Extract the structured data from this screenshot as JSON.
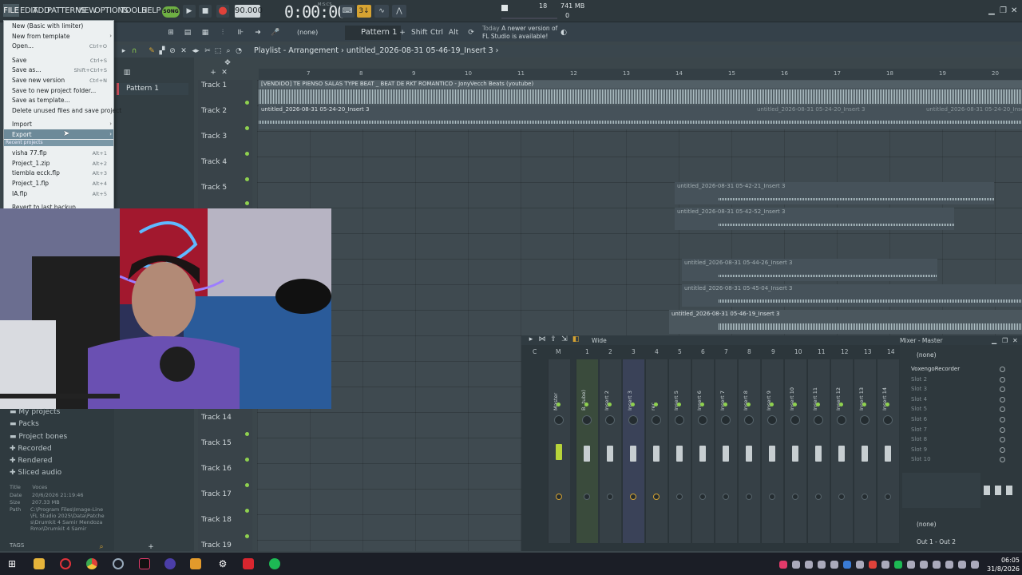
{
  "menu": {
    "items": [
      "FILE",
      "EDIT",
      "ADD",
      "PATTERNS",
      "VIEW",
      "OPTIONS",
      "TOOLS",
      "HELP"
    ],
    "song_label": "SONG"
  },
  "transport": {
    "tempo": "90.000",
    "time": "0:00:00",
    "time_unit": "M:S:CS",
    "cpu": "18",
    "cpu_zero": "0",
    "memory": "741 MB"
  },
  "toolbar2": {
    "none_selector": "(none)",
    "pattern_selector": "Pattern 1",
    "shift": "Shift",
    "ctrl": "Ctrl",
    "alt": "Alt",
    "news_today": "Today",
    "news_text": "A newer version of FL Studio is available!"
  },
  "playlist": {
    "title": "Playlist - Arrangement",
    "breadcrumb": "untitled_2026-08-31 05-46-19_Insert 3",
    "pattern": "Pattern 1",
    "ruler": [
      "7",
      "8",
      "9",
      "10",
      "11",
      "12",
      "13",
      "14",
      "15",
      "16",
      "17",
      "18",
      "19",
      "20"
    ],
    "tracks": [
      "Track 1",
      "Track 2",
      "Track 3",
      "Track 4",
      "Track 5",
      "Track 14",
      "Track 15",
      "Track 16",
      "Track 17",
      "Track 18",
      "Track 19"
    ],
    "clips": [
      "[VENDIDO] TE PIENSO SALAS TYPE BEAT _ BEAT DE RKT ROMANTICO - JonyVecch Beats (youtube)",
      "untitled_2026-08-31 05-24-20_Insert 3",
      "untitled_2026-08-31 05-24-20_Insert 3",
      "untitled_2026-08-31 05-24-20_Insert 3",
      "untitled_2026-08-31 05-42-21_Insert 3",
      "untitled_2026-08-31 05-42-52_Insert 3",
      "untitled_2026-08-31 05-44-26_Insert 3",
      "untitled_2026-08-31 05-45-04_Insert 3",
      "untitled_2026-08-31 05-46-19_Insert 3"
    ]
  },
  "file_menu": {
    "items": [
      {
        "label": "New (Basic with limiter)",
        "shortcut": ""
      },
      {
        "label": "New from template",
        "shortcut": "",
        "arrow": "›"
      },
      {
        "label": "Open...",
        "shortcut": "Ctrl+O"
      },
      {
        "label": "Save",
        "shortcut": "Ctrl+S"
      },
      {
        "label": "Save as...",
        "shortcut": "Shift+Ctrl+S"
      },
      {
        "label": "Save new version",
        "shortcut": "Ctrl+N"
      },
      {
        "label": "Save to new project folder...",
        "shortcut": ""
      },
      {
        "label": "Save as template...",
        "shortcut": ""
      },
      {
        "label": "Delete unused files and save project",
        "shortcut": ""
      },
      {
        "label": "Import",
        "shortcut": "",
        "arrow": "›"
      },
      {
        "label": "Export",
        "shortcut": "",
        "arrow": "›"
      }
    ],
    "recent_header": "Recent projects",
    "recent": [
      {
        "label": "visha 77.flp",
        "shortcut": "Alt+1"
      },
      {
        "label": "Project_1.zip",
        "shortcut": "Alt+2"
      },
      {
        "label": "tiembla ecck.flp",
        "shortcut": "Alt+3"
      },
      {
        "label": "Project_1.flp",
        "shortcut": "Alt+4"
      },
      {
        "label": "IA.flp",
        "shortcut": "Alt+5"
      }
    ],
    "revert": "Revert to last backup"
  },
  "browser": {
    "items": [
      "My projects",
      "Packs",
      "Project bones",
      "Recorded",
      "Rendered",
      "Sliced audio"
    ],
    "info": {
      "title_label": "Title",
      "title": "Voces",
      "date_label": "Date",
      "date": "20/6/2026 21:19:46",
      "size_label": "Size",
      "size": "207.33 MB",
      "path_label": "Path",
      "path": "C:\\Program Files\\Image-Line\\FL Studio 2025\\Data\\Patches\\Drumkit 4 Samir Mendoza Rmx\\Drumkit 4 Samir"
    },
    "tags": "TAGS"
  },
  "mixer": {
    "toolbar_label": "Wide",
    "title": "Mixer - Master",
    "numbers": [
      "C",
      "M",
      "1",
      "2",
      "3",
      "4",
      "5",
      "6",
      "7",
      "8",
      "9",
      "10",
      "11",
      "12",
      "13",
      "14"
    ],
    "strips": [
      "Master",
      "B. tube)",
      "Insert 2",
      "Insert 3",
      "rec",
      "Insert 5",
      "Insert 6",
      "Insert 7",
      "Insert 8",
      "Insert 9",
      "Insert 10",
      "Insert 11",
      "Insert 12",
      "Insert 13",
      "Insert 14"
    ],
    "input": "(none)",
    "slots": [
      "VoxengoRecorder",
      "Slot 2",
      "Slot 3",
      "Slot 4",
      "Slot 5",
      "Slot 6",
      "Slot 7",
      "Slot 8",
      "Slot 9",
      "Slot 10"
    ],
    "send_none": "(none)",
    "output": "Out 1 - Out 2"
  },
  "taskbar": {
    "time": "06:05",
    "date": "31/8/2026"
  },
  "colors": {
    "accent_green": "#8fd14f",
    "record_red": "#e0423a",
    "step_orange": "#d6a332"
  }
}
